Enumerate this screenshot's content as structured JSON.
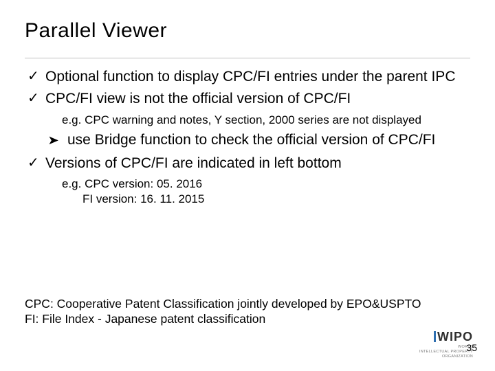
{
  "title": "Parallel Viewer",
  "bullets": {
    "b1": "Optional function to display CPC/FI entries under the parent IPC",
    "b2": "CPC/FI view is not the official version of CPC/FI",
    "b2_eg_label": "e.g. ",
    "b2_eg_body": "CPC warning and notes, Y section, 2000 series are not displayed",
    "b2_arrow": "use Bridge function to check the official version of CPC/FI",
    "b3": "Versions of CPC/FI are indicated in left bottom",
    "b3_eg_label": "e.g. ",
    "b3_eg_line1": "CPC version: 05. 2016",
    "b3_eg_line2": "FI version: 16. 11. 2015"
  },
  "footnote": {
    "line1": "CPC: Cooperative Patent Classification jointly developed by EPO&USPTO",
    "line2": "FI: File Index - Japanese patent classification"
  },
  "logo": {
    "main": "WIPO",
    "sub1": "WORLD",
    "sub2": "INTELLECTUAL PROPERTY",
    "sub3": "ORGANIZATION"
  },
  "page_number": "35"
}
